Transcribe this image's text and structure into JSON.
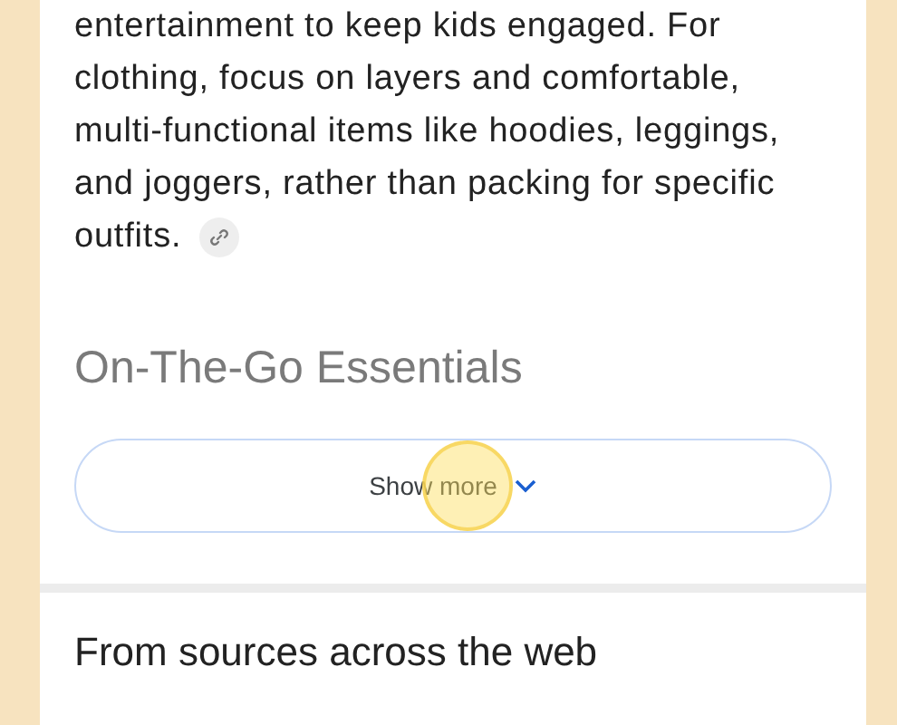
{
  "overview": {
    "paragraph": "entertainment to keep kids engaged. For clothing, focus on layers and comfortable, multi-functional items like hoodies, leggings, and joggers, rather than packing for specific outfits.",
    "heading": "On-The-Go Essentials",
    "heading_faded": true
  },
  "show_more_button": {
    "label": "Show more",
    "tap_indicator": true
  },
  "sources": {
    "heading": "From sources across the web"
  }
}
